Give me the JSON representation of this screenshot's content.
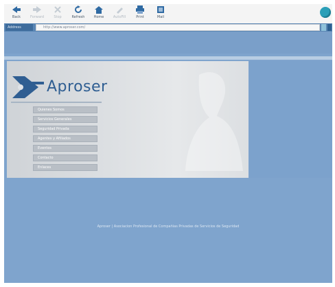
{
  "toolbar": {
    "buttons": [
      {
        "label": "Back",
        "icon": "back-arrow-icon",
        "enabled": true
      },
      {
        "label": "Forward",
        "icon": "forward-arrow-icon",
        "enabled": false
      },
      {
        "label": "Stop",
        "icon": "stop-icon",
        "enabled": false
      },
      {
        "label": "Refresh",
        "icon": "refresh-icon",
        "enabled": true
      },
      {
        "label": "Home",
        "icon": "home-icon",
        "enabled": true
      },
      {
        "label": "AutoFill",
        "icon": "autofill-icon",
        "enabled": false
      },
      {
        "label": "Print",
        "icon": "print-icon",
        "enabled": true
      },
      {
        "label": "Mail",
        "icon": "mail-icon",
        "enabled": true
      }
    ],
    "accent_color": "#2a9fb8"
  },
  "address_bar": {
    "label": "Address",
    "url": "http://www.aproser.com/"
  },
  "page": {
    "brand": "Aproser",
    "menu": [
      "Quienes Somos",
      "Servicios Generales",
      "Seguridad Privada",
      "Agentes y Afiliados",
      "Eventos",
      "Contacto",
      "Enlaces"
    ],
    "footer": "Aproser | Asociacion Profesional de Compañias Privadas de Servicios de Seguridad"
  }
}
